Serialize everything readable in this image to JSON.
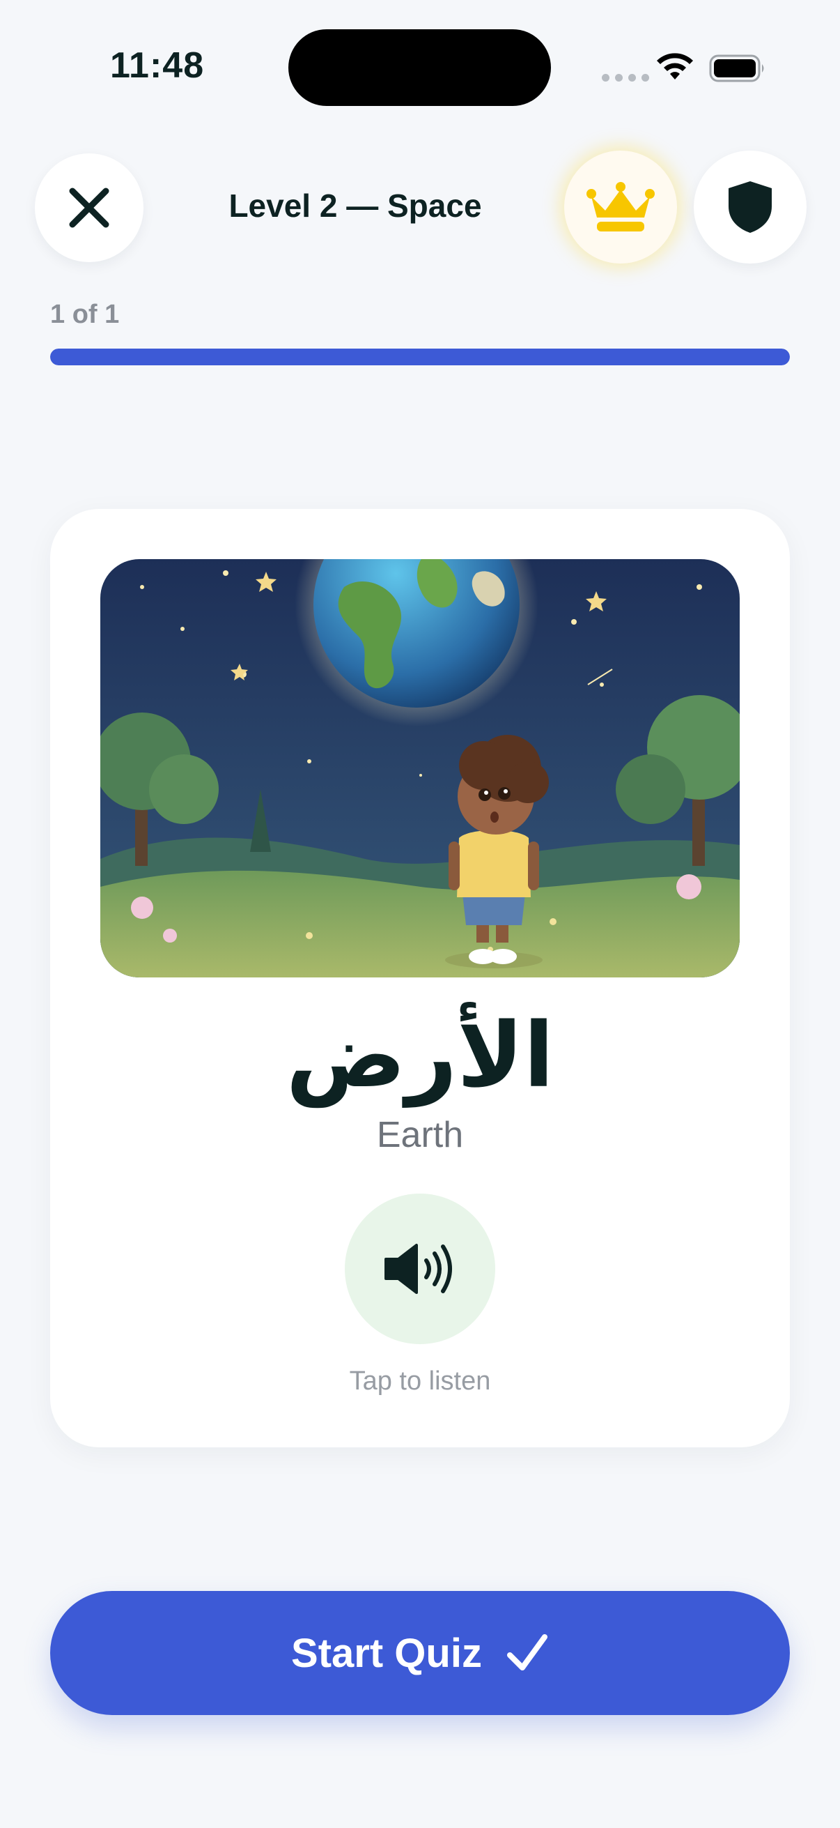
{
  "status_bar": {
    "time": "11:48"
  },
  "header": {
    "title": "Level 2 — Space",
    "close_icon": "close-icon",
    "crown_icon": "crown-icon",
    "shield_icon": "shield-icon"
  },
  "progress": {
    "counter": "1 of 1",
    "current": 1,
    "total": 1,
    "fill_fraction": 1.0,
    "color": "#3d5ad6"
  },
  "card": {
    "image_icon": "illustration-earth",
    "word_arabic": "الأرض",
    "word_english": "Earth",
    "audio_icon": "speaker-icon",
    "audio_hint": "Tap to listen"
  },
  "actions": {
    "start_label": "Start Quiz",
    "start_icon": "checkmark-icon"
  },
  "colors": {
    "accent": "#3d5ad6",
    "crown": "#f7c600",
    "audio_bg": "#e8f5e9",
    "text_dark": "#0d2222"
  }
}
